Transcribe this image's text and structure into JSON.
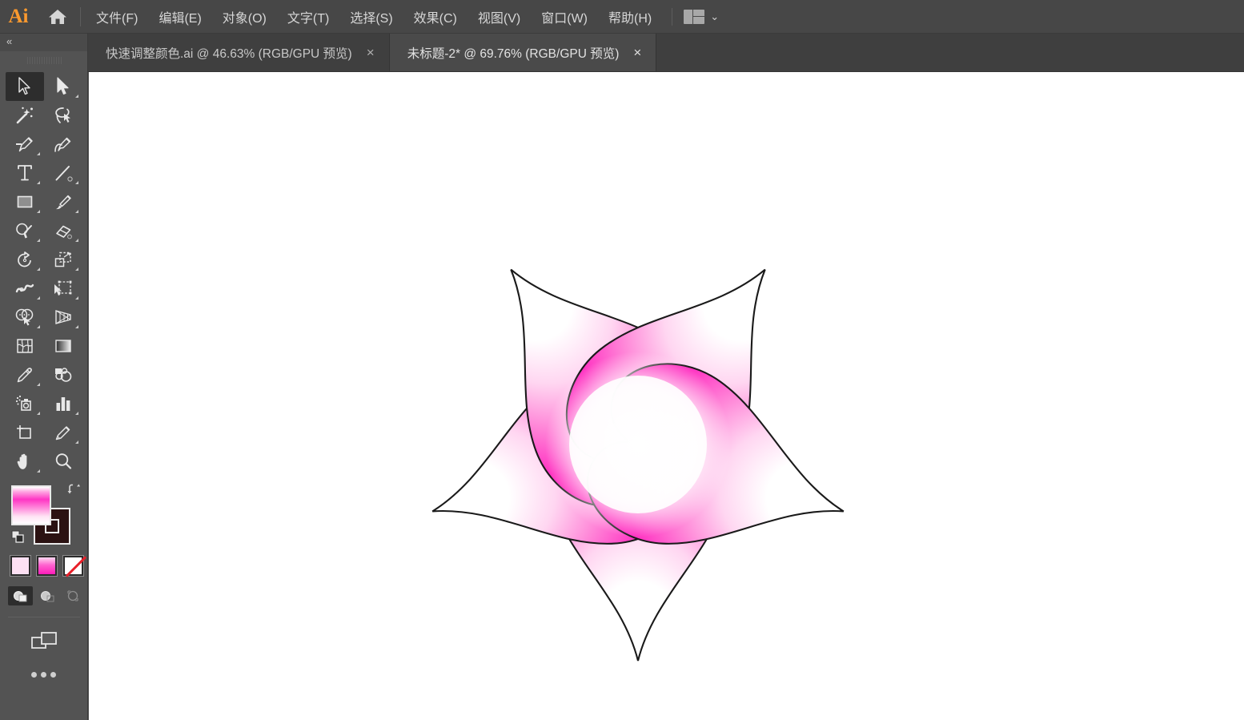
{
  "app": {
    "name": "Adobe Illustrator",
    "logo_text": "Ai",
    "home_icon": "home-icon",
    "workspace_icon": "workspace-switcher-icon",
    "workspace_chevron": "⌄"
  },
  "menubar": {
    "items": [
      {
        "label": "文件(F)",
        "text": "文件(",
        "key": "F",
        "tail": ")"
      },
      {
        "label": "编辑(E)",
        "text": "编辑(",
        "key": "E",
        "tail": ")"
      },
      {
        "label": "对象(O)",
        "text": "对象(",
        "key": "O",
        "tail": ")"
      },
      {
        "label": "文字(T)",
        "text": "文字(",
        "key": "T",
        "tail": ")"
      },
      {
        "label": "选择(S)",
        "text": "选择(",
        "key": "S",
        "tail": ")"
      },
      {
        "label": "效果(C)",
        "text": "效果(",
        "key": "C",
        "tail": ")"
      },
      {
        "label": "视图(V)",
        "text": "视图(",
        "key": "V",
        "tail": ")"
      },
      {
        "label": "窗口(W)",
        "text": "窗口(",
        "key": "W",
        "tail": ")"
      },
      {
        "label": "帮助(H)",
        "text": "帮助(",
        "key": "H",
        "tail": ")"
      }
    ]
  },
  "tabs": [
    {
      "title": "快速调整颜色.ai @ 46.63% (RGB/GPU 预览)",
      "filename": "快速调整颜色.ai",
      "zoom": "46.63%",
      "mode": "(RGB/GPU 预览)",
      "active": false,
      "close_glyph": "×"
    },
    {
      "title": "未标题-2* @ 69.76% (RGB/GPU 预览)",
      "filename": "未标题-2*",
      "zoom": "69.76%",
      "mode": "(RGB/GPU 预览)",
      "active": true,
      "close_glyph": "×"
    }
  ],
  "toolpanel": {
    "collapse_glyph": "«",
    "tools": [
      {
        "name": "selection-tool",
        "label": "选择工具",
        "active": true,
        "has_flyout": false
      },
      {
        "name": "direct-selection-tool",
        "label": "直接选择工具",
        "active": false,
        "has_flyout": true
      },
      {
        "name": "magic-wand-tool",
        "label": "魔棒工具",
        "active": false,
        "has_flyout": false
      },
      {
        "name": "lasso-tool",
        "label": "套索工具",
        "active": false,
        "has_flyout": false
      },
      {
        "name": "pen-tool",
        "label": "钢笔工具",
        "active": false,
        "has_flyout": true
      },
      {
        "name": "curvature-tool",
        "label": "曲率工具",
        "active": false,
        "has_flyout": false
      },
      {
        "name": "type-tool",
        "label": "文字工具",
        "active": false,
        "has_flyout": true
      },
      {
        "name": "line-segment-tool",
        "label": "直线段工具",
        "active": false,
        "has_flyout": true
      },
      {
        "name": "rectangle-tool",
        "label": "矩形工具",
        "active": false,
        "has_flyout": true
      },
      {
        "name": "paintbrush-tool",
        "label": "画笔工具",
        "active": false,
        "has_flyout": true
      },
      {
        "name": "shaper-tool",
        "label": "Shaper 工具",
        "active": false,
        "has_flyout": true
      },
      {
        "name": "eraser-tool",
        "label": "橡皮擦工具",
        "active": false,
        "has_flyout": true
      },
      {
        "name": "rotate-tool",
        "label": "旋转工具",
        "active": false,
        "has_flyout": true
      },
      {
        "name": "scale-tool",
        "label": "缩放工具",
        "active": false,
        "has_flyout": true
      },
      {
        "name": "width-tool",
        "label": "宽度工具",
        "active": false,
        "has_flyout": true
      },
      {
        "name": "free-transform-tool",
        "label": "自由变换工具",
        "active": false,
        "has_flyout": true
      },
      {
        "name": "shape-builder-tool",
        "label": "形状生成器工具",
        "active": false,
        "has_flyout": true
      },
      {
        "name": "perspective-grid-tool",
        "label": "透视网格工具",
        "active": false,
        "has_flyout": true
      },
      {
        "name": "mesh-tool",
        "label": "网格工具",
        "active": false,
        "has_flyout": false
      },
      {
        "name": "gradient-tool",
        "label": "渐变工具",
        "active": false,
        "has_flyout": false
      },
      {
        "name": "eyedropper-tool",
        "label": "吸管工具",
        "active": false,
        "has_flyout": true
      },
      {
        "name": "blend-tool",
        "label": "混合工具",
        "active": false,
        "has_flyout": false
      },
      {
        "name": "symbol-sprayer-tool",
        "label": "符号喷枪工具",
        "active": false,
        "has_flyout": true
      },
      {
        "name": "column-graph-tool",
        "label": "柱形图工具",
        "active": false,
        "has_flyout": true
      },
      {
        "name": "artboard-tool",
        "label": "画板工具",
        "active": false,
        "has_flyout": false
      },
      {
        "name": "slice-tool",
        "label": "切片工具",
        "active": false,
        "has_flyout": true
      },
      {
        "name": "hand-tool",
        "label": "抓手工具",
        "active": false,
        "has_flyout": true
      },
      {
        "name": "zoom-tool",
        "label": "缩放工具",
        "active": false,
        "has_flyout": false
      }
    ],
    "fill_swatch": {
      "name": "fill-color",
      "type": "gradient",
      "colors": [
        "#ffffff",
        "#ff35c4",
        "#ffffff"
      ]
    },
    "stroke_swatch": {
      "name": "stroke-color",
      "type": "solid",
      "color": "#2b1212"
    },
    "swap_icon": "swap-fill-stroke-icon",
    "default_icon": "default-fill-stroke-icon",
    "mini_swatches": [
      {
        "name": "color-swatch",
        "type": "solid",
        "color": "#fde0f3"
      },
      {
        "name": "gradient-swatch",
        "type": "gradient",
        "color": "#ff1bb9"
      },
      {
        "name": "none-swatch",
        "type": "none",
        "color": "#ffffff"
      }
    ],
    "draw_modes": [
      {
        "name": "draw-normal-mode",
        "active": true
      },
      {
        "name": "draw-behind-mode",
        "active": false
      },
      {
        "name": "draw-inside-mode",
        "active": false
      }
    ],
    "screen_mode_icon": "screen-mode-icon",
    "more_tools_icon": "edit-toolbar-ellipsis-icon"
  },
  "canvas": {
    "background": "#ffffff",
    "artwork": {
      "name": "sakura-flower",
      "description": "五瓣樱花",
      "petal_count": 5,
      "stroke_color": "#1a1a1a",
      "gradient_outer": "#ff2dc0",
      "gradient_mid": "#ff8bd9",
      "gradient_inner": "#ffffff"
    }
  }
}
